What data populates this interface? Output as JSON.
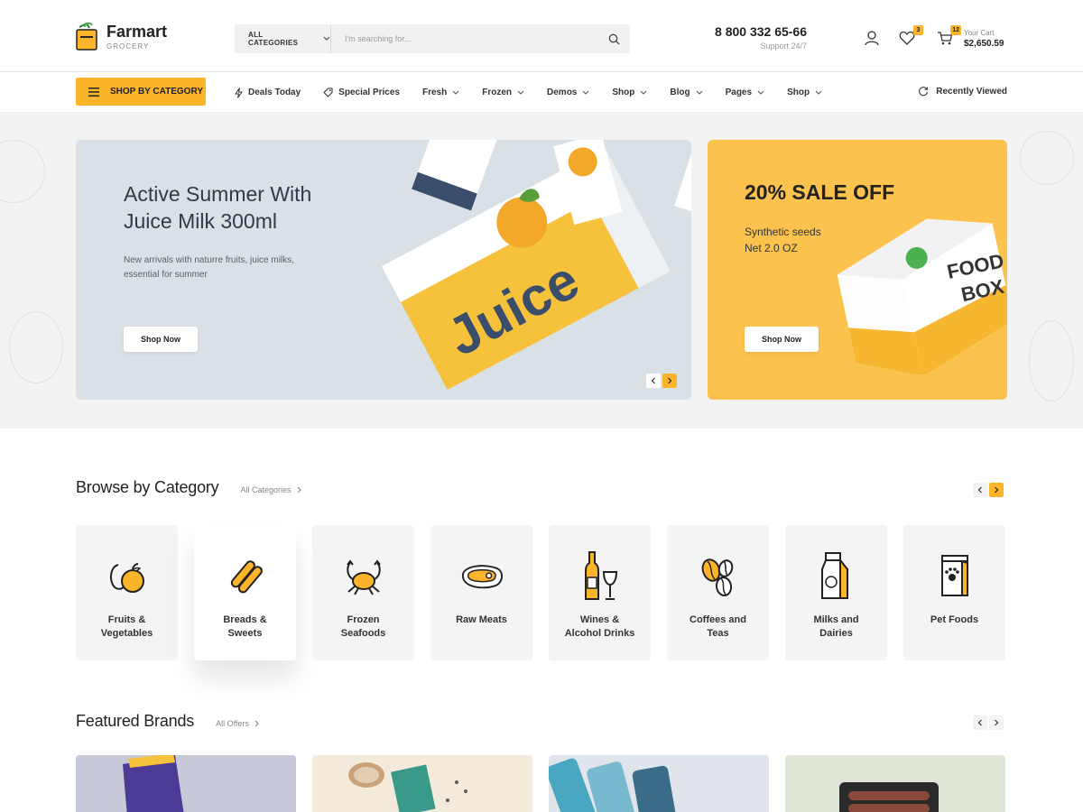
{
  "header": {
    "logo_name": "Farmart",
    "logo_sub": "GROCERY",
    "search": {
      "category_label": "ALL CATEGORIES",
      "placeholder": "I'm searching for..."
    },
    "phone": "8 800 332 65-66",
    "support": "Support 24/7",
    "wishlist_count": "3",
    "cart_count": "12",
    "cart_label": "Your Cart",
    "cart_total": "$2,650.59"
  },
  "nav": {
    "shop_by_category": "SHOP BY CATEGORY",
    "items": [
      "Deals Today",
      "Special Prices",
      "Fresh",
      "Frozen",
      "Demos",
      "Shop",
      "Blog",
      "Pages",
      "Shop"
    ],
    "recently_viewed": "Recently Viewed"
  },
  "hero": {
    "main": {
      "title": "Active Summer With Juice Milk 300ml",
      "description": "New arrivals with naturre  fruits, juice milks, essential for summer",
      "button": "Shop Now"
    },
    "side": {
      "title": "20% SALE OFF",
      "line1": "Synthetic seeds",
      "line2": "Net 2.0 OZ",
      "button": "Shop Now"
    }
  },
  "browse": {
    "title": "Browse by Category",
    "link": "All Categories",
    "categories": [
      {
        "line1": "Fruits &",
        "line2": "Vegetables",
        "icon": "fruits-icon"
      },
      {
        "line1": "Breads &",
        "line2": "Sweets",
        "icon": "bread-icon"
      },
      {
        "line1": "Frozen",
        "line2": "Seafoods",
        "icon": "crab-icon"
      },
      {
        "line1": "Raw Meats",
        "line2": "",
        "icon": "meat-icon"
      },
      {
        "line1": "Wines &",
        "line2": "Alcohol Drinks",
        "icon": "wine-icon"
      },
      {
        "line1": "Coffees and",
        "line2": "Teas",
        "icon": "coffee-icon"
      },
      {
        "line1": "Milks and",
        "line2": "Dairies",
        "icon": "milk-icon"
      },
      {
        "line1": "Pet Foods",
        "line2": "",
        "icon": "pet-food-icon"
      }
    ]
  },
  "brands": {
    "title": "Featured Brands",
    "link": "All Offers"
  },
  "colors": {
    "accent": "#fcb42a",
    "hero_main_bg": "#d9e0e6",
    "hero_side_bg": "#fbc24e",
    "card_bg": "#f4f4f4"
  }
}
